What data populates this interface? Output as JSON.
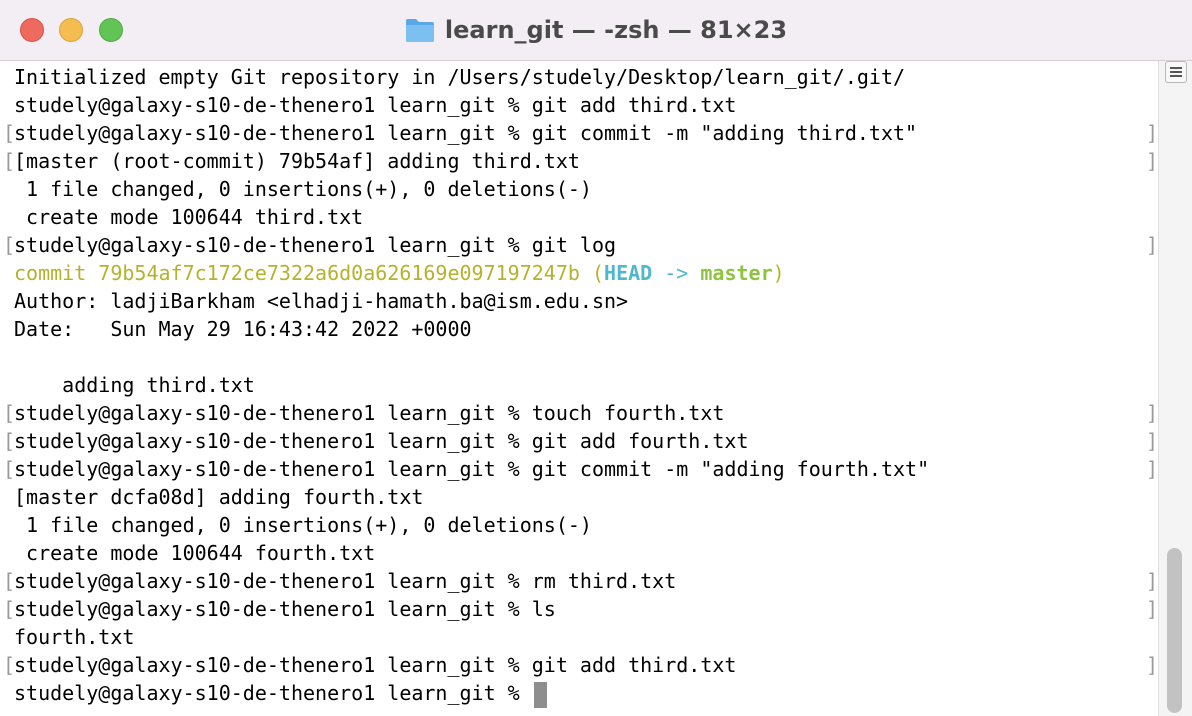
{
  "window": {
    "title": "learn_git — -zsh — 81×23",
    "icon": "folder-icon"
  },
  "terminal": {
    "lines": [
      "Initialized empty Git repository in /Users/studely/Desktop/learn_git/.git/",
      "studely@galaxy-s10-de-thenero1 learn_git % git add third.txt",
      "studely@galaxy-s10-de-thenero1 learn_git % git commit -m \"adding third.txt\"",
      "[master (root-commit) 79b54af] adding third.txt",
      " 1 file changed, 0 insertions(+), 0 deletions(-)",
      " create mode 100644 third.txt",
      "studely@galaxy-s10-de-thenero1 learn_git % git log",
      {
        "commit_prefix": "commit 79b54af7c172ce7322a6d0a626169e097197247b",
        "open_paren": " (",
        "head": "HEAD",
        "arrow": " -> ",
        "branch": "master",
        "close_paren": ")"
      },
      "Author: ladjiBarkham <elhadji-hamath.ba@ism.edu.sn>",
      "Date:   Sun May 29 16:43:42 2022 +0000",
      "",
      "    adding third.txt",
      "studely@galaxy-s10-de-thenero1 learn_git % touch fourth.txt",
      "studely@galaxy-s10-de-thenero1 learn_git % git add fourth.txt",
      "studely@galaxy-s10-de-thenero1 learn_git % git commit -m \"adding fourth.txt\"",
      "[master dcfa08d] adding fourth.txt",
      " 1 file changed, 0 insertions(+), 0 deletions(-)",
      " create mode 100644 fourth.txt",
      "studely@galaxy-s10-de-thenero1 learn_git % rm third.txt",
      "studely@galaxy-s10-de-thenero1 learn_git % ls",
      "fourth.txt",
      "studely@galaxy-s10-de-thenero1 learn_git % git add third.txt",
      "studely@galaxy-s10-de-thenero1 learn_git % "
    ],
    "bracket_left": "[",
    "bracket_right": "]"
  },
  "colors": {
    "commit_hash": "#b5b22e",
    "head": "#4fb8cc",
    "branch": "#8fc43e"
  }
}
